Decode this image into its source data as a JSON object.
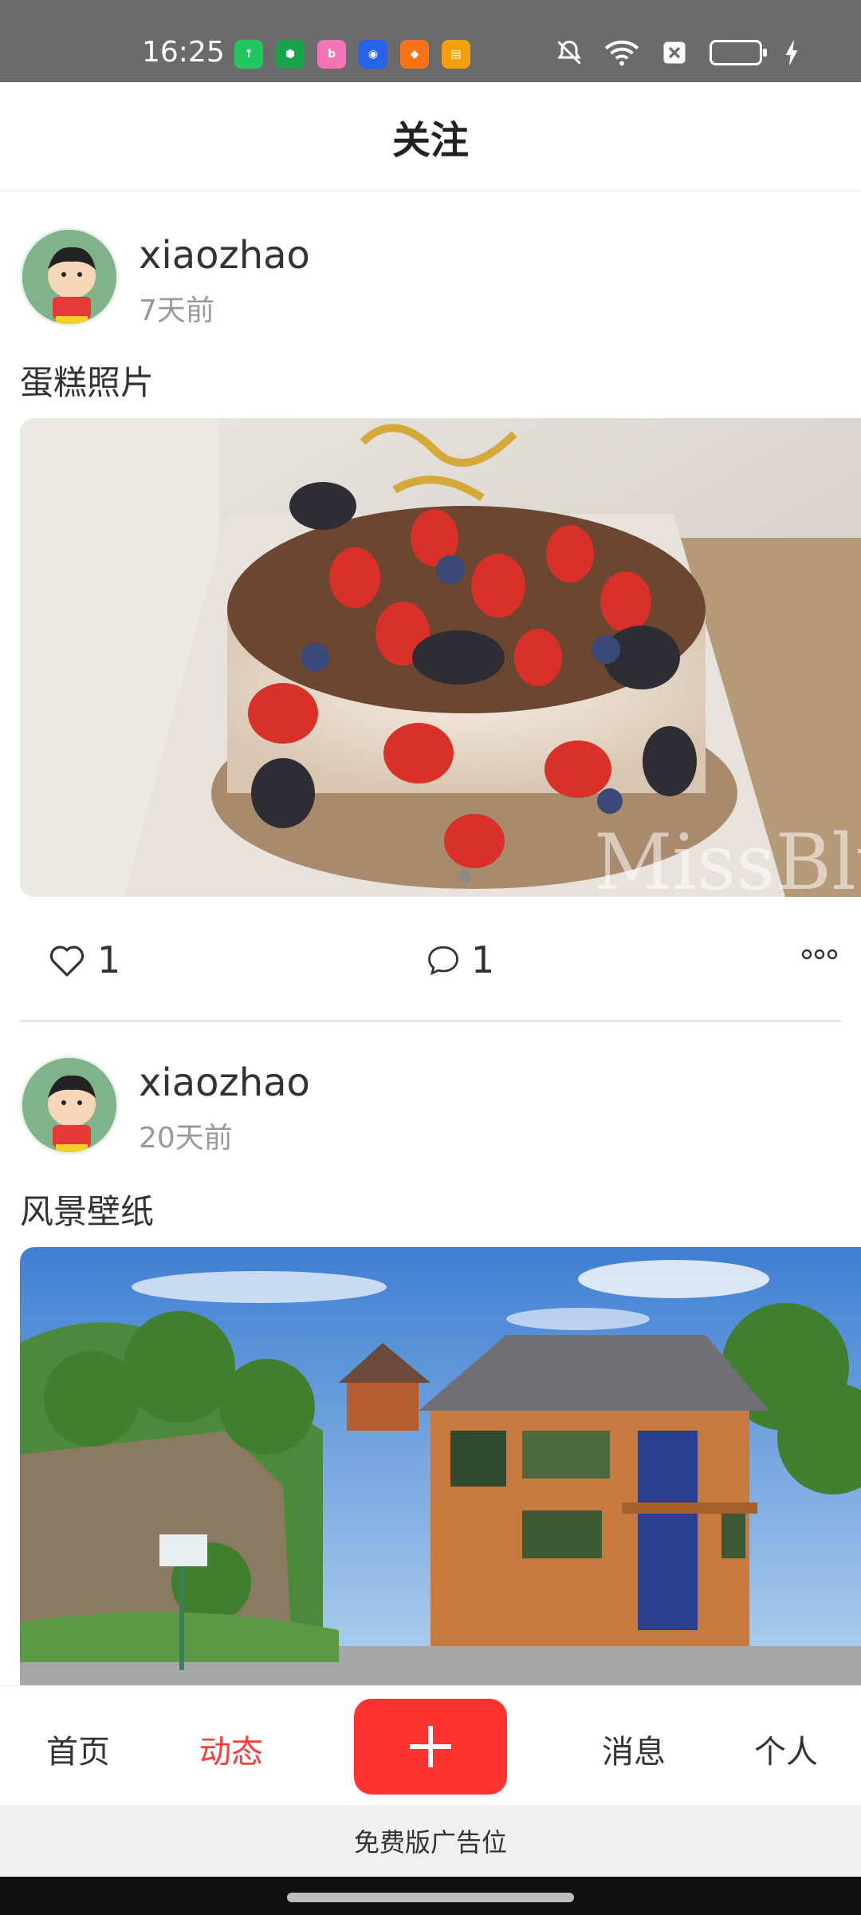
{
  "status_bar": {
    "time": "16:25",
    "notification_icons": [
      {
        "name": "upload-app-icon",
        "color": "#22c55e",
        "glyph": "↑"
      },
      {
        "name": "shield-app-icon",
        "color": "#16a34a",
        "glyph": "⬢"
      },
      {
        "name": "bilibili-app-icon",
        "color": "#f472b6",
        "glyph": "b"
      },
      {
        "name": "circle-app-icon",
        "color": "#2563eb",
        "glyph": "◉"
      },
      {
        "name": "game-app-icon",
        "color": "#f97316",
        "glyph": "◆"
      },
      {
        "name": "wallet-app-icon",
        "color": "#f59e0b",
        "glyph": "▤"
      }
    ]
  },
  "header": {
    "title": "关注"
  },
  "posts": [
    {
      "username": "xiaozhao",
      "time": "7天前",
      "caption": "蛋糕照片",
      "likes": "1",
      "comments": "1",
      "image_label": "cake-photo"
    },
    {
      "username": "xiaozhao",
      "time": "20天前",
      "caption": "风景壁纸",
      "likes": "",
      "comments": "",
      "image_label": "landscape-photo"
    }
  ],
  "nav": {
    "home": "首页",
    "feed": "动态",
    "messages": "消息",
    "profile": "个人"
  },
  "ad": {
    "text": "免费版广告位"
  },
  "colors": {
    "accent": "#ff3232",
    "active_nav": "#ff3b3b"
  }
}
